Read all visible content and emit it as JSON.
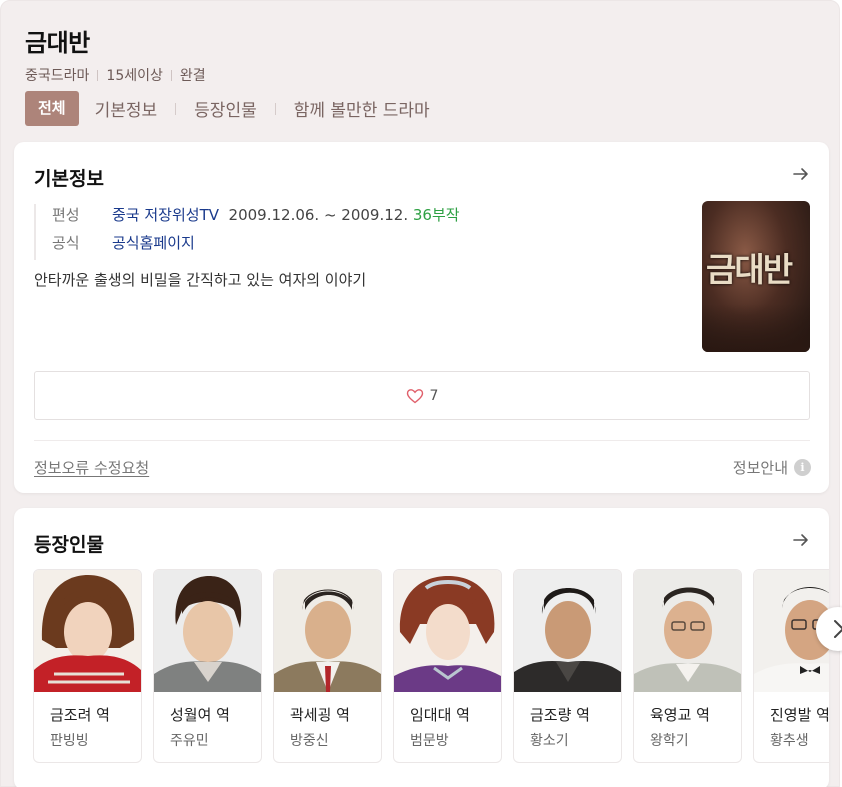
{
  "header": {
    "title": "금대반",
    "meta": [
      "중국드라마",
      "15세이상",
      "완결"
    ]
  },
  "tabs": [
    "전체",
    "기본정보",
    "등장인물",
    "함께 볼만한 드라마"
  ],
  "basic_info": {
    "title": "기본정보",
    "broadcast_label": "편성",
    "broadcast_channel": "중국 저장위성TV",
    "broadcast_dates": "2009.12.06. ~ 2009.12.",
    "episodes": "36부작",
    "official_label": "공식",
    "official_link": "공식홈페이지",
    "description": "안타까운 출생의 비밀을 간직하고 있는 여자의 이야기",
    "poster_title": "금대반",
    "like_count": "7",
    "report_label": "정보오류 수정요청",
    "guide_label": "정보안내"
  },
  "cast_section": {
    "title": "등장인물",
    "cast": [
      {
        "role": "금조려 역",
        "actor": "판빙빙"
      },
      {
        "role": "성월여 역",
        "actor": "주유민"
      },
      {
        "role": "곽세굉 역",
        "actor": "방중신"
      },
      {
        "role": "임대대 역",
        "actor": "범문방"
      },
      {
        "role": "금조량 역",
        "actor": "황소기"
      },
      {
        "role": "육영교 역",
        "actor": "왕학기"
      },
      {
        "role": "진영발 역",
        "actor": "황추생"
      }
    ]
  },
  "colors": {
    "background": "#f3eeee",
    "active_tab": "#ad847a",
    "link": "#1a3a8c",
    "episodes": "#2ea043",
    "heart": "#e0606b"
  },
  "icons": [
    "arrow-right-icon",
    "heart-icon",
    "info-icon",
    "chevron-right-icon"
  ]
}
